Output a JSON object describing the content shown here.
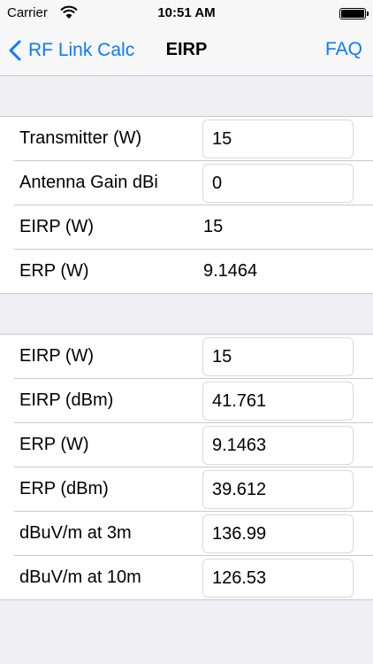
{
  "status_bar": {
    "carrier": "Carrier",
    "time": "10:51 AM",
    "icons": [
      "wifi-icon",
      "battery-icon"
    ]
  },
  "nav": {
    "back_label": "RF Link Calc",
    "title": "EIRP",
    "faq_label": "FAQ",
    "accent_color": "#0a7aff"
  },
  "section1": [
    {
      "label": "Transmitter (W)",
      "value": "15",
      "editable": true
    },
    {
      "label": "Antenna Gain dBi",
      "value": "0",
      "editable": true
    },
    {
      "label": "EIRP (W)",
      "value": "15",
      "editable": false
    },
    {
      "label": "ERP (W)",
      "value": "9.1464",
      "editable": false
    }
  ],
  "section2": [
    {
      "label": "EIRP (W)",
      "value": "15",
      "editable": true
    },
    {
      "label": "EIRP (dBm)",
      "value": "41.761",
      "editable": true
    },
    {
      "label": "ERP (W)",
      "value": "9.1463",
      "editable": true
    },
    {
      "label": "ERP (dBm)",
      "value": "39.612",
      "editable": true
    },
    {
      "label": "dBuV/m at 3m",
      "value": "136.99",
      "editable": true
    },
    {
      "label": "dBuV/m at 10m",
      "value": "126.53",
      "editable": true
    }
  ]
}
